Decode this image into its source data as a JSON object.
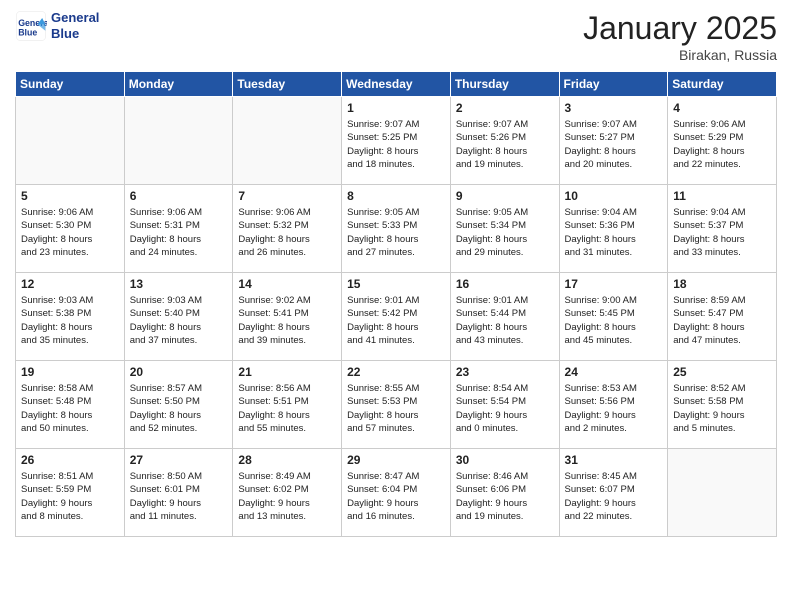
{
  "header": {
    "logo_line1": "General",
    "logo_line2": "Blue",
    "month": "January 2025",
    "location": "Birakan, Russia"
  },
  "weekdays": [
    "Sunday",
    "Monday",
    "Tuesday",
    "Wednesday",
    "Thursday",
    "Friday",
    "Saturday"
  ],
  "weeks": [
    [
      {
        "day": "",
        "info": ""
      },
      {
        "day": "",
        "info": ""
      },
      {
        "day": "",
        "info": ""
      },
      {
        "day": "1",
        "info": "Sunrise: 9:07 AM\nSunset: 5:25 PM\nDaylight: 8 hours\nand 18 minutes."
      },
      {
        "day": "2",
        "info": "Sunrise: 9:07 AM\nSunset: 5:26 PM\nDaylight: 8 hours\nand 19 minutes."
      },
      {
        "day": "3",
        "info": "Sunrise: 9:07 AM\nSunset: 5:27 PM\nDaylight: 8 hours\nand 20 minutes."
      },
      {
        "day": "4",
        "info": "Sunrise: 9:06 AM\nSunset: 5:29 PM\nDaylight: 8 hours\nand 22 minutes."
      }
    ],
    [
      {
        "day": "5",
        "info": "Sunrise: 9:06 AM\nSunset: 5:30 PM\nDaylight: 8 hours\nand 23 minutes."
      },
      {
        "day": "6",
        "info": "Sunrise: 9:06 AM\nSunset: 5:31 PM\nDaylight: 8 hours\nand 24 minutes."
      },
      {
        "day": "7",
        "info": "Sunrise: 9:06 AM\nSunset: 5:32 PM\nDaylight: 8 hours\nand 26 minutes."
      },
      {
        "day": "8",
        "info": "Sunrise: 9:05 AM\nSunset: 5:33 PM\nDaylight: 8 hours\nand 27 minutes."
      },
      {
        "day": "9",
        "info": "Sunrise: 9:05 AM\nSunset: 5:34 PM\nDaylight: 8 hours\nand 29 minutes."
      },
      {
        "day": "10",
        "info": "Sunrise: 9:04 AM\nSunset: 5:36 PM\nDaylight: 8 hours\nand 31 minutes."
      },
      {
        "day": "11",
        "info": "Sunrise: 9:04 AM\nSunset: 5:37 PM\nDaylight: 8 hours\nand 33 minutes."
      }
    ],
    [
      {
        "day": "12",
        "info": "Sunrise: 9:03 AM\nSunset: 5:38 PM\nDaylight: 8 hours\nand 35 minutes."
      },
      {
        "day": "13",
        "info": "Sunrise: 9:03 AM\nSunset: 5:40 PM\nDaylight: 8 hours\nand 37 minutes."
      },
      {
        "day": "14",
        "info": "Sunrise: 9:02 AM\nSunset: 5:41 PM\nDaylight: 8 hours\nand 39 minutes."
      },
      {
        "day": "15",
        "info": "Sunrise: 9:01 AM\nSunset: 5:42 PM\nDaylight: 8 hours\nand 41 minutes."
      },
      {
        "day": "16",
        "info": "Sunrise: 9:01 AM\nSunset: 5:44 PM\nDaylight: 8 hours\nand 43 minutes."
      },
      {
        "day": "17",
        "info": "Sunrise: 9:00 AM\nSunset: 5:45 PM\nDaylight: 8 hours\nand 45 minutes."
      },
      {
        "day": "18",
        "info": "Sunrise: 8:59 AM\nSunset: 5:47 PM\nDaylight: 8 hours\nand 47 minutes."
      }
    ],
    [
      {
        "day": "19",
        "info": "Sunrise: 8:58 AM\nSunset: 5:48 PM\nDaylight: 8 hours\nand 50 minutes."
      },
      {
        "day": "20",
        "info": "Sunrise: 8:57 AM\nSunset: 5:50 PM\nDaylight: 8 hours\nand 52 minutes."
      },
      {
        "day": "21",
        "info": "Sunrise: 8:56 AM\nSunset: 5:51 PM\nDaylight: 8 hours\nand 55 minutes."
      },
      {
        "day": "22",
        "info": "Sunrise: 8:55 AM\nSunset: 5:53 PM\nDaylight: 8 hours\nand 57 minutes."
      },
      {
        "day": "23",
        "info": "Sunrise: 8:54 AM\nSunset: 5:54 PM\nDaylight: 9 hours\nand 0 minutes."
      },
      {
        "day": "24",
        "info": "Sunrise: 8:53 AM\nSunset: 5:56 PM\nDaylight: 9 hours\nand 2 minutes."
      },
      {
        "day": "25",
        "info": "Sunrise: 8:52 AM\nSunset: 5:58 PM\nDaylight: 9 hours\nand 5 minutes."
      }
    ],
    [
      {
        "day": "26",
        "info": "Sunrise: 8:51 AM\nSunset: 5:59 PM\nDaylight: 9 hours\nand 8 minutes."
      },
      {
        "day": "27",
        "info": "Sunrise: 8:50 AM\nSunset: 6:01 PM\nDaylight: 9 hours\nand 11 minutes."
      },
      {
        "day": "28",
        "info": "Sunrise: 8:49 AM\nSunset: 6:02 PM\nDaylight: 9 hours\nand 13 minutes."
      },
      {
        "day": "29",
        "info": "Sunrise: 8:47 AM\nSunset: 6:04 PM\nDaylight: 9 hours\nand 16 minutes."
      },
      {
        "day": "30",
        "info": "Sunrise: 8:46 AM\nSunset: 6:06 PM\nDaylight: 9 hours\nand 19 minutes."
      },
      {
        "day": "31",
        "info": "Sunrise: 8:45 AM\nSunset: 6:07 PM\nDaylight: 9 hours\nand 22 minutes."
      },
      {
        "day": "",
        "info": ""
      }
    ]
  ]
}
